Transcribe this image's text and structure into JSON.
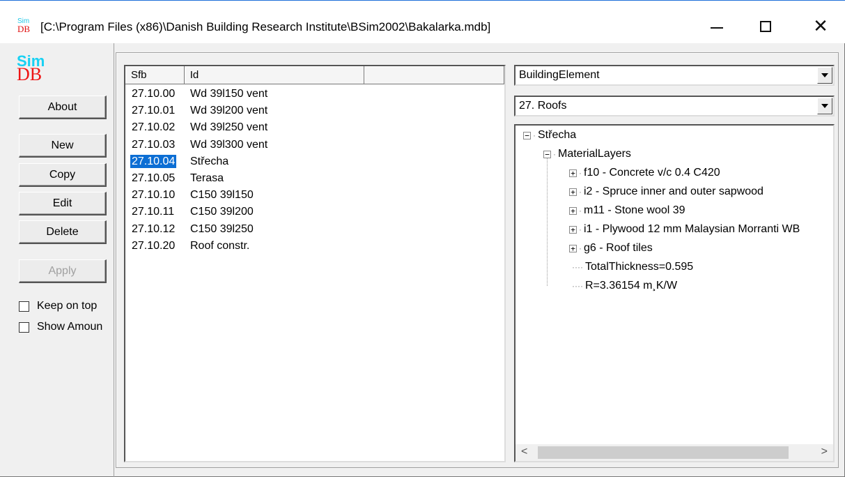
{
  "window": {
    "title": "[C:\\Program Files (x86)\\Danish Building Research Institute\\BSim2002\\Bakalarka.mdb]",
    "icon_top": "Sim",
    "icon_bottom": "DB"
  },
  "logo": {
    "sim": "Sim",
    "db": "DB"
  },
  "buttons": {
    "about": "About",
    "new": "New",
    "copy": "Copy",
    "edit": "Edit",
    "delete": "Delete",
    "apply": "Apply"
  },
  "checkboxes": {
    "keep_on_top": {
      "label": "Keep on top",
      "checked": false
    },
    "show_amount": {
      "label": "Show Amoun",
      "checked": false
    }
  },
  "list": {
    "columns": [
      "Sfb",
      "Id",
      ""
    ],
    "rows": [
      {
        "sfb": "27.10.00",
        "id": "Wd 39l150 vent"
      },
      {
        "sfb": "27.10.01",
        "id": "Wd 39l200 vent"
      },
      {
        "sfb": "27.10.02",
        "id": "Wd 39l250 vent"
      },
      {
        "sfb": "27.10.03",
        "id": "Wd 39l300 vent"
      },
      {
        "sfb": "27.10.04",
        "id": "Střecha"
      },
      {
        "sfb": "27.10.05",
        "id": "Terasa"
      },
      {
        "sfb": "27.10.10",
        "id": "C150 39l150"
      },
      {
        "sfb": "27.10.11",
        "id": "C150 39l200"
      },
      {
        "sfb": "27.10.12",
        "id": "C150 39l250"
      },
      {
        "sfb": "27.10.20",
        "id": "Roof constr."
      }
    ],
    "selected_index": 4
  },
  "combos": {
    "type": "BuildingElement",
    "category": "27. Roofs"
  },
  "tree": {
    "root": "Střecha",
    "material_layers": "MaterialLayers",
    "layers": [
      "f10 - Concrete v/c 0.4 C420",
      "i2 - Spruce inner and outer sapwood",
      "m11 - Stone wool 39",
      "i1 - Plywood 12 mm Malaysian Morranti WB",
      "g6 - Roof tiles"
    ],
    "total_thickness": "TotalThickness=0.595",
    "r_value": "R=3.36154 m¸K/W"
  },
  "scrollbar": {
    "left_arrow": "<",
    "right_arrow": ">"
  }
}
